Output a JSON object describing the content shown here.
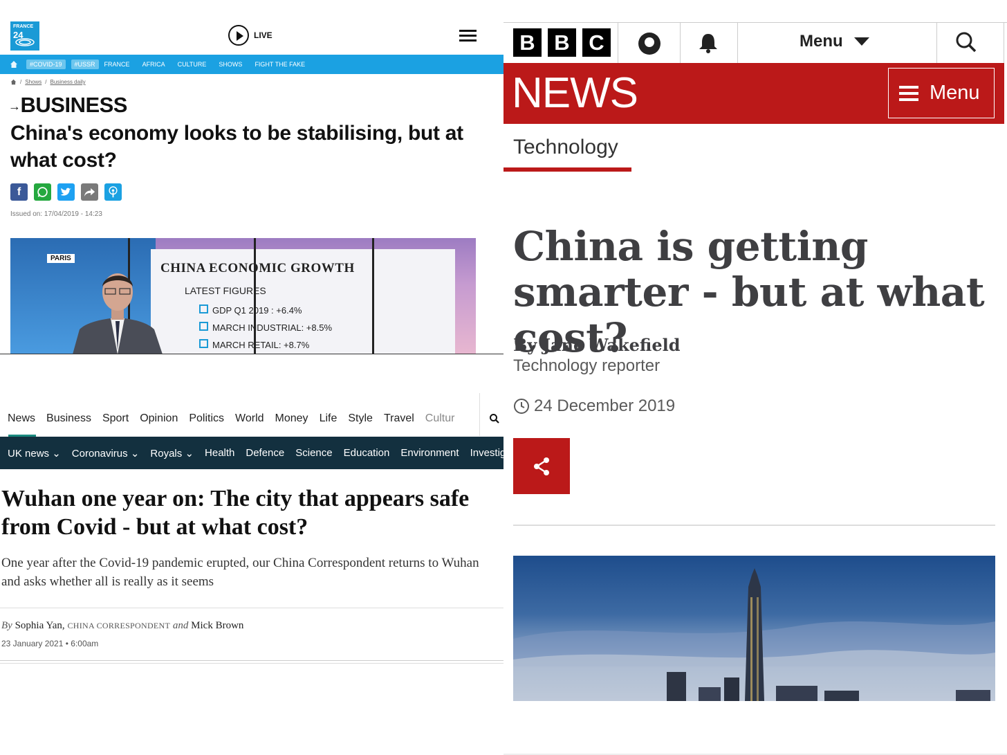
{
  "france24": {
    "logo_line1": "FRANCE",
    "logo_line2": "24",
    "live_label": "LIVE",
    "nav_tags": [
      "#COVID-19",
      "#USSR"
    ],
    "nav_links": [
      "FRANCE",
      "AFRICA",
      "CULTURE",
      "SHOWS",
      "FIGHT THE FAKE"
    ],
    "breadcrumb": [
      "Shows",
      "Business daily"
    ],
    "section": "BUSINESS",
    "headline": "China's economy looks to be stabilising, but at what cost?",
    "issued": "Issued on: 17/04/2019 - 14:23",
    "video": {
      "location_tag": "PARIS",
      "board_title": "CHINA ECONOMIC GROWTH",
      "board_subtitle": "LATEST FIGURES",
      "board_items": [
        "GDP Q1 2019 : +6.4%",
        "MARCH INDUSTRIAL: +8.5%",
        "MARCH RETAIL: +8.7%"
      ]
    },
    "colors": {
      "brand_blue": "#1ba1e2"
    }
  },
  "telegraph": {
    "nav_items": [
      "News",
      "Business",
      "Sport",
      "Opinion",
      "Politics",
      "World",
      "Money",
      "Life",
      "Style",
      "Travel",
      "Cultur"
    ],
    "sub_items": [
      "UK news",
      "Coronavirus",
      "Royals",
      "Health",
      "Defence",
      "Science",
      "Education",
      "Environment",
      "Investigatio"
    ],
    "sub_dropdowns": [
      "UK news",
      "Coronavirus",
      "Royals"
    ],
    "headline": "Wuhan one year on: The city that appears safe from Covid - but at what cost?",
    "standfirst": "One year after the Covid-19 pandemic erupted, our China Correspondent returns to Wuhan and asks whether all is really as it seems",
    "byline": {
      "by": "By",
      "author1": "Sophia Yan,",
      "role": "CHINA CORRESPONDENT",
      "and": "and",
      "author2": "Mick Brown"
    },
    "date": "23 January 2021 • 6:00am",
    "colors": {
      "bar": "#13303f",
      "accent": "#1b8a7f"
    }
  },
  "bbc": {
    "logo_letters": [
      "B",
      "B",
      "C"
    ],
    "top_menu_label": "Menu",
    "news_wordmark": "NEWS",
    "news_menu_label": "Menu",
    "section": "Technology",
    "headline": "China is getting smarter - but at what cost?",
    "author": "By Jane Wakefield",
    "author_role": "Technology reporter",
    "date": "24 December 2019",
    "colors": {
      "red": "#bb1919"
    }
  }
}
